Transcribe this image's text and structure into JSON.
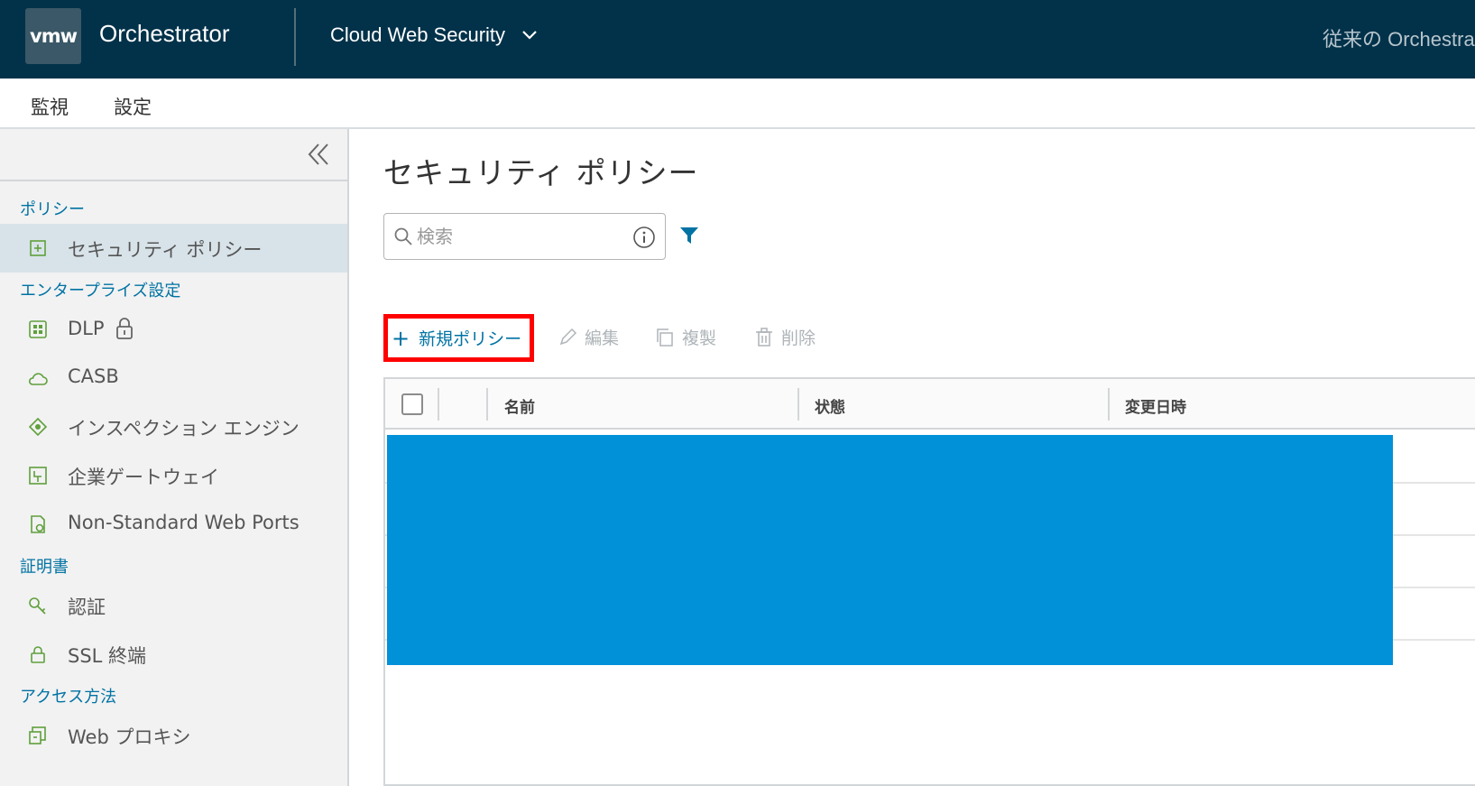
{
  "header": {
    "logo": "vmw",
    "app_title": "Orchestrator",
    "workspace": "Cloud Web Security",
    "legacy_link": "従来の Orchestrator"
  },
  "tabs": [
    {
      "label": "監視"
    },
    {
      "label": "設定",
      "active": true
    }
  ],
  "sidebar": {
    "sections": [
      {
        "label": "ポリシー"
      },
      {
        "label": "エンタープライズ設定"
      },
      {
        "label": "証明書"
      },
      {
        "label": "アクセス方法"
      }
    ],
    "items": [
      {
        "label": "セキュリティ ポリシー",
        "icon": "security-policy-icon",
        "active": true
      },
      {
        "label": "DLP",
        "icon": "dlp-icon",
        "locked": true
      },
      {
        "label": "CASB",
        "icon": "cloud-icon"
      },
      {
        "label": "インスペクション エンジン",
        "icon": "inspection-engine-icon"
      },
      {
        "label": "企業ゲートウェイ",
        "icon": "gateway-icon"
      },
      {
        "label": "Non-Standard Web Ports",
        "icon": "web-ports-icon"
      },
      {
        "label": "認証",
        "icon": "key-icon"
      },
      {
        "label": "SSL 終端",
        "icon": "lock-icon"
      },
      {
        "label": "Web プロキシ",
        "icon": "web-proxy-icon"
      }
    ]
  },
  "main": {
    "title": "セキュリティ ポリシー",
    "search": {
      "placeholder": "検索",
      "value": ""
    },
    "toolbar": {
      "new_policy": "新規ポリシー",
      "edit": "編集",
      "duplicate": "複製",
      "delete": "削除"
    },
    "table": {
      "columns": [
        "名前",
        "状態",
        "変更日時"
      ]
    }
  },
  "colors": {
    "header_bg": "#02324a",
    "accent": "#0072a3",
    "highlight_border": "#ff0000",
    "redaction": "#0091d9"
  }
}
